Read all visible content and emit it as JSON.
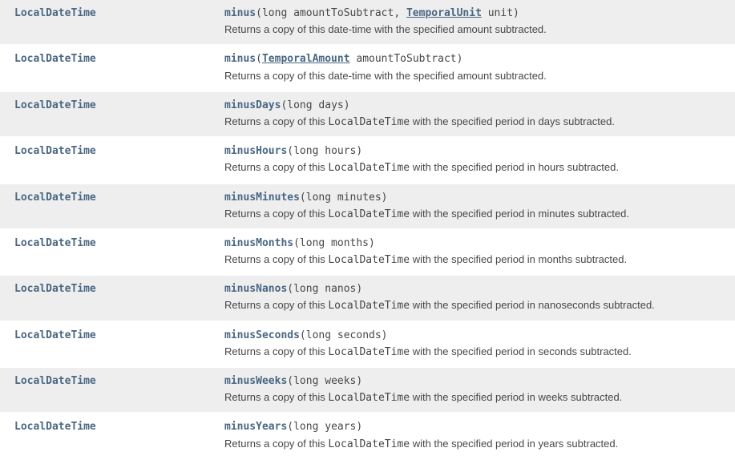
{
  "methods": [
    {
      "returnType": "LocalDateTime",
      "name": "minus",
      "sigPrefix": "(long amountToSubtract, ",
      "sigLink": "TemporalUnit",
      "sigSuffix": " unit)",
      "descPrefix": "Returns a copy of this date-time with the specified amount subtracted.",
      "descCode": "",
      "descSuffix": ""
    },
    {
      "returnType": "LocalDateTime",
      "name": "minus",
      "sigPrefix": "(",
      "sigLink": "TemporalAmount",
      "sigSuffix": " amountToSubtract)",
      "descPrefix": "Returns a copy of this date-time with the specified amount subtracted.",
      "descCode": "",
      "descSuffix": ""
    },
    {
      "returnType": "LocalDateTime",
      "name": "minusDays",
      "sigPrefix": "(long days)",
      "sigLink": "",
      "sigSuffix": "",
      "descPrefix": "Returns a copy of this ",
      "descCode": "LocalDateTime",
      "descSuffix": " with the specified period in days subtracted."
    },
    {
      "returnType": "LocalDateTime",
      "name": "minusHours",
      "sigPrefix": "(long hours)",
      "sigLink": "",
      "sigSuffix": "",
      "descPrefix": "Returns a copy of this ",
      "descCode": "LocalDateTime",
      "descSuffix": " with the specified period in hours subtracted."
    },
    {
      "returnType": "LocalDateTime",
      "name": "minusMinutes",
      "sigPrefix": "(long minutes)",
      "sigLink": "",
      "sigSuffix": "",
      "descPrefix": "Returns a copy of this ",
      "descCode": "LocalDateTime",
      "descSuffix": " with the specified period in minutes subtracted."
    },
    {
      "returnType": "LocalDateTime",
      "name": "minusMonths",
      "sigPrefix": "(long months)",
      "sigLink": "",
      "sigSuffix": "",
      "descPrefix": "Returns a copy of this ",
      "descCode": "LocalDateTime",
      "descSuffix": " with the specified period in months subtracted."
    },
    {
      "returnType": "LocalDateTime",
      "name": "minusNanos",
      "sigPrefix": "(long nanos)",
      "sigLink": "",
      "sigSuffix": "",
      "descPrefix": "Returns a copy of this ",
      "descCode": "LocalDateTime",
      "descSuffix": " with the specified period in nanoseconds subtracted."
    },
    {
      "returnType": "LocalDateTime",
      "name": "minusSeconds",
      "sigPrefix": "(long seconds)",
      "sigLink": "",
      "sigSuffix": "",
      "descPrefix": "Returns a copy of this ",
      "descCode": "LocalDateTime",
      "descSuffix": " with the specified period in seconds subtracted."
    },
    {
      "returnType": "LocalDateTime",
      "name": "minusWeeks",
      "sigPrefix": "(long weeks)",
      "sigLink": "",
      "sigSuffix": "",
      "descPrefix": "Returns a copy of this ",
      "descCode": "LocalDateTime",
      "descSuffix": " with the specified period in weeks subtracted."
    },
    {
      "returnType": "LocalDateTime",
      "name": "minusYears",
      "sigPrefix": "(long years)",
      "sigLink": "",
      "sigSuffix": "",
      "descPrefix": "Returns a copy of this ",
      "descCode": "LocalDateTime",
      "descSuffix": " with the specified period in years subtracted."
    }
  ]
}
